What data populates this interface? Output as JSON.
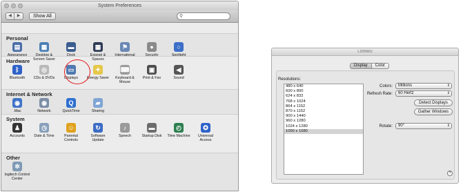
{
  "syspref": {
    "title": "System Preferences",
    "back": "◀",
    "forward": "▶",
    "show_all": "Show All",
    "search_placeholder": "",
    "sections": [
      {
        "title": "Personal",
        "items": [
          {
            "label": "Appearance",
            "icon": "appearance-icon",
            "glyph": "▤",
            "color": "#4b6ea8"
          },
          {
            "label": "Desktop & Screen Saver",
            "icon": "desktop-icon",
            "glyph": "▦",
            "color": "#4a7fb5"
          },
          {
            "label": "Dock",
            "icon": "dock-icon",
            "glyph": "▬",
            "color": "#3a5d8f"
          },
          {
            "label": "Exposé & Spaces",
            "icon": "expose-icon",
            "glyph": "▦",
            "color": "#2f3b55"
          },
          {
            "label": "International",
            "icon": "globe-flag-icon",
            "glyph": "⚑",
            "color": "#6a88b5"
          },
          {
            "label": "Security",
            "icon": "lock-icon",
            "glyph": "●",
            "color": "#8a8a8a"
          },
          {
            "label": "Spotlight",
            "icon": "spotlight-icon",
            "glyph": "○",
            "color": "#3c6fc7"
          }
        ]
      },
      {
        "title": "Hardware",
        "items": [
          {
            "label": "Bluetooth",
            "icon": "bluetooth-icon",
            "glyph": "ᛒ",
            "color": "#2f62c9"
          },
          {
            "label": "CDs & DVDs",
            "icon": "disc-icon",
            "glyph": "◎",
            "color": "#b9b9b9"
          },
          {
            "label": "Displays",
            "icon": "display-icon",
            "glyph": "▭",
            "color": "#4f79b0"
          },
          {
            "label": "Energy Saver",
            "icon": "lightbulb-icon",
            "glyph": "✦",
            "color": "#e5c84a"
          },
          {
            "label": "Keyboard & Mouse",
            "icon": "keyboard-icon",
            "glyph": "⌨",
            "color": "#9a9a9a"
          },
          {
            "label": "Print & Fax",
            "icon": "printer-icon",
            "glyph": "▣",
            "color": "#4d4d4d"
          },
          {
            "label": "Sound",
            "icon": "speaker-icon",
            "glyph": "◀",
            "color": "#555555"
          }
        ]
      },
      {
        "title": "Internet & Network",
        "items": [
          {
            "label": ".Mac",
            "icon": "mac-icon",
            "glyph": "◉",
            "color": "#3f73c6"
          },
          {
            "label": "Network",
            "icon": "network-icon",
            "glyph": "◉",
            "color": "#7c8ea6"
          },
          {
            "label": "QuickTime",
            "icon": "quicktime-icon",
            "glyph": "Q",
            "color": "#2e6fd0"
          },
          {
            "label": "Sharing",
            "icon": "folder-icon",
            "glyph": "▰",
            "color": "#7fa5d4"
          }
        ]
      },
      {
        "title": "System",
        "items": [
          {
            "label": "Accounts",
            "icon": "accounts-icon",
            "glyph": "♟",
            "color": "#333333"
          },
          {
            "label": "Date & Time",
            "icon": "clock-icon",
            "glyph": "◷",
            "color": "#8aa0bb"
          },
          {
            "label": "Parental Controls",
            "icon": "parental-controls-icon",
            "glyph": "☺",
            "color": "#e0a21e"
          },
          {
            "label": "Software Update",
            "icon": "software-update-icon",
            "glyph": "↻",
            "color": "#3c6cc4"
          },
          {
            "label": "Speech",
            "icon": "microphone-icon",
            "glyph": "♪",
            "color": "#9a9a9a"
          },
          {
            "label": "Startup Disk",
            "icon": "disk-icon",
            "glyph": "▬",
            "color": "#6c6c6c"
          },
          {
            "label": "Time Machine",
            "icon": "time-machine-icon",
            "glyph": "◴",
            "color": "#2d7f4f"
          },
          {
            "label": "Universal Access",
            "icon": "universal-access-icon",
            "glyph": "✪",
            "color": "#2f62c9"
          }
        ]
      },
      {
        "title": "Other",
        "items": [
          {
            "label": "logitech Control Center",
            "icon": "logitech-icon",
            "glyph": "✲",
            "color": "#7f9ab5"
          }
        ]
      }
    ]
  },
  "display": {
    "title": "L205WU",
    "tabs": [
      "Display",
      "Color"
    ],
    "resolutions_label": "Resolutions:",
    "resolutions": [
      "480 x 640",
      "600 x 800",
      "624 x 832",
      "768 x 1024",
      "864 x 1152",
      "870 x 1152",
      "900 x 1440",
      "960 x 1280",
      "1024 x 1280",
      "1050 x 1680"
    ],
    "selected_resolution_index": 9,
    "colors_label": "Colors:",
    "colors_value": "Millions",
    "refresh_label": "Refresh Rate:",
    "refresh_value": "60 Hertz",
    "detect_button": "Detect Displays",
    "gather_button": "Gather Windows",
    "rotate_label": "Rotate:",
    "rotate_value": "90°",
    "help": "?"
  }
}
